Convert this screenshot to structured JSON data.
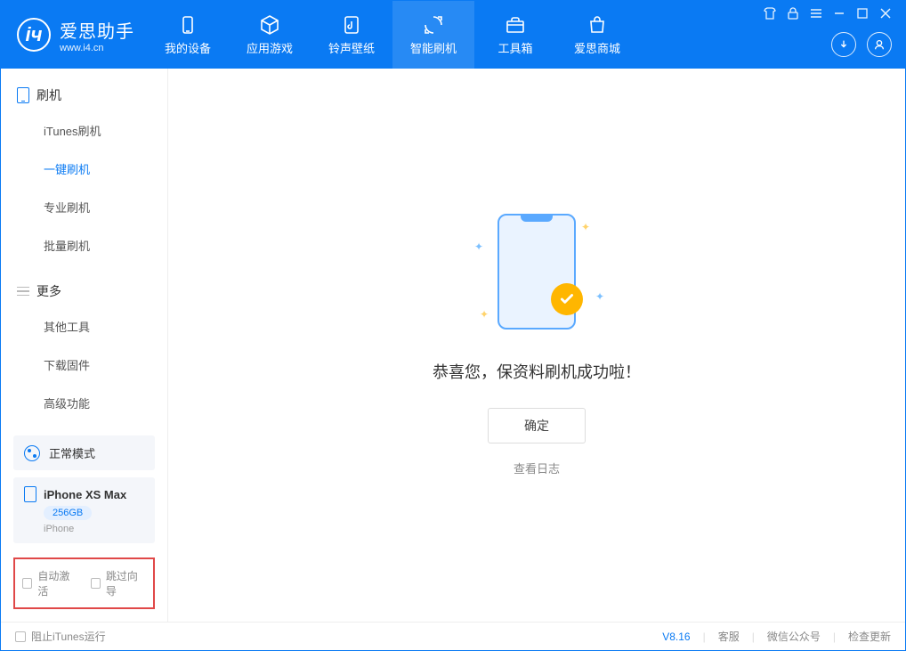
{
  "app": {
    "title": "爱思助手",
    "subtitle": "www.i4.cn"
  },
  "nav": {
    "items": [
      {
        "label": "我的设备"
      },
      {
        "label": "应用游戏"
      },
      {
        "label": "铃声壁纸"
      },
      {
        "label": "智能刷机"
      },
      {
        "label": "工具箱"
      },
      {
        "label": "爱思商城"
      }
    ]
  },
  "sidebar": {
    "section1": {
      "title": "刷机",
      "items": [
        {
          "label": "iTunes刷机"
        },
        {
          "label": "一键刷机"
        },
        {
          "label": "专业刷机"
        },
        {
          "label": "批量刷机"
        }
      ]
    },
    "section2": {
      "title": "更多",
      "items": [
        {
          "label": "其他工具"
        },
        {
          "label": "下载固件"
        },
        {
          "label": "高级功能"
        }
      ]
    },
    "mode": "正常模式",
    "device": {
      "name": "iPhone XS Max",
      "storage": "256GB",
      "type": "iPhone"
    },
    "opts": {
      "auto_activate": "自动激活",
      "skip_guide": "跳过向导"
    }
  },
  "main": {
    "success": "恭喜您，保资料刷机成功啦！",
    "confirm": "确定",
    "log_link": "查看日志"
  },
  "footer": {
    "block_itunes": "阻止iTunes运行",
    "version": "V8.16",
    "support": "客服",
    "wechat": "微信公众号",
    "update": "检查更新"
  }
}
